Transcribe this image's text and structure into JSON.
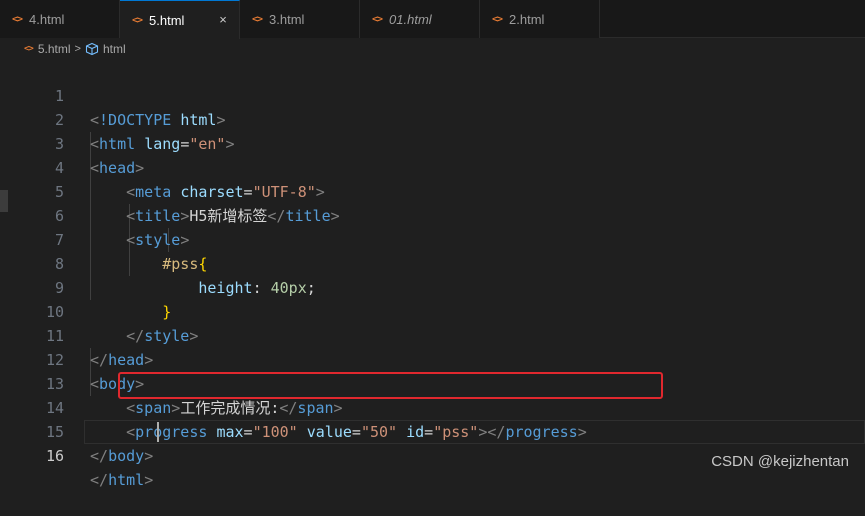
{
  "tabs": [
    {
      "label": "4.html",
      "active": false,
      "italic": false
    },
    {
      "label": "5.html",
      "active": true,
      "italic": false
    },
    {
      "label": "3.html",
      "active": false,
      "italic": false
    },
    {
      "label": "01.html",
      "active": false,
      "italic": true
    },
    {
      "label": "2.html",
      "active": false,
      "italic": false
    }
  ],
  "tab_icon": "<>",
  "tab_close_icon": "×",
  "breadcrumb": {
    "file": "5.html",
    "separator": ">",
    "element": "html"
  },
  "line_numbers": [
    "1",
    "2",
    "3",
    "4",
    "5",
    "6",
    "7",
    "8",
    "9",
    "10",
    "11",
    "12",
    "13",
    "14",
    "15",
    "16"
  ],
  "current_line": 16,
  "code": {
    "l1": {
      "open": "<",
      "doctype": "!DOCTYPE",
      "sp": " ",
      "html": "html",
      "close": ">"
    },
    "l2": {
      "open": "<",
      "tag": "html",
      "sp": " ",
      "attr": "lang",
      "eq": "=",
      "val": "\"en\"",
      "close": ">"
    },
    "l3": {
      "open": "<",
      "tag": "head",
      "close": ">"
    },
    "l4": {
      "indent": "    ",
      "open": "<",
      "tag": "meta",
      "sp": " ",
      "attr": "charset",
      "eq": "=",
      "val": "\"UTF-8\"",
      "close": ">"
    },
    "l5": {
      "indent": "    ",
      "open": "<",
      "tag": "title",
      "close": ">",
      "text": "H5新增标签",
      "open2": "</",
      "tag2": "title",
      "close2": ">"
    },
    "l6": {
      "indent": "    ",
      "open": "<",
      "tag": "style",
      "close": ">"
    },
    "l7": {
      "indent": "        ",
      "selector": "#pss",
      "brace": "{"
    },
    "l8": {
      "indent": "            ",
      "prop": "height",
      "colon": ": ",
      "num": "40px",
      "semi": ";"
    },
    "l9": {
      "indent": "        ",
      "brace": "}"
    },
    "l10": {
      "indent": "    ",
      "open": "</",
      "tag": "style",
      "close": ">"
    },
    "l11": {
      "open": "</",
      "tag": "head",
      "close": ">"
    },
    "l12": {
      "open": "<",
      "tag": "body",
      "close": ">"
    },
    "l13": {
      "indent": "    ",
      "open": "<",
      "tag": "span",
      "close": ">",
      "text": "工作完成情况:",
      "open2": "</",
      "tag2": "span",
      "close2": ">"
    },
    "l14": {
      "indent": "    ",
      "open": "<",
      "tag": "progress",
      "sp1": " ",
      "attr1": "max",
      "eq1": "=",
      "val1": "\"100\"",
      "sp2": " ",
      "attr2": "value",
      "eq2": "=",
      "val2": "\"50\"",
      "sp3": " ",
      "attr3": "id",
      "eq3": "=",
      "val3": "\"pss\"",
      "close": ">",
      "open2": "</",
      "tag2": "progress",
      "close2": ">"
    },
    "l15": {
      "open": "</",
      "tag": "body",
      "close": ">"
    },
    "l16": {
      "open": "</",
      "tag": "html",
      "close": ">"
    }
  },
  "watermark": "CSDN @kejizhentan",
  "colors": {
    "tag": "#569cd6",
    "attr": "#9cdcfe",
    "string": "#ce9178",
    "highlight_box": "#e0282e",
    "tab_icon": "#e37933"
  }
}
